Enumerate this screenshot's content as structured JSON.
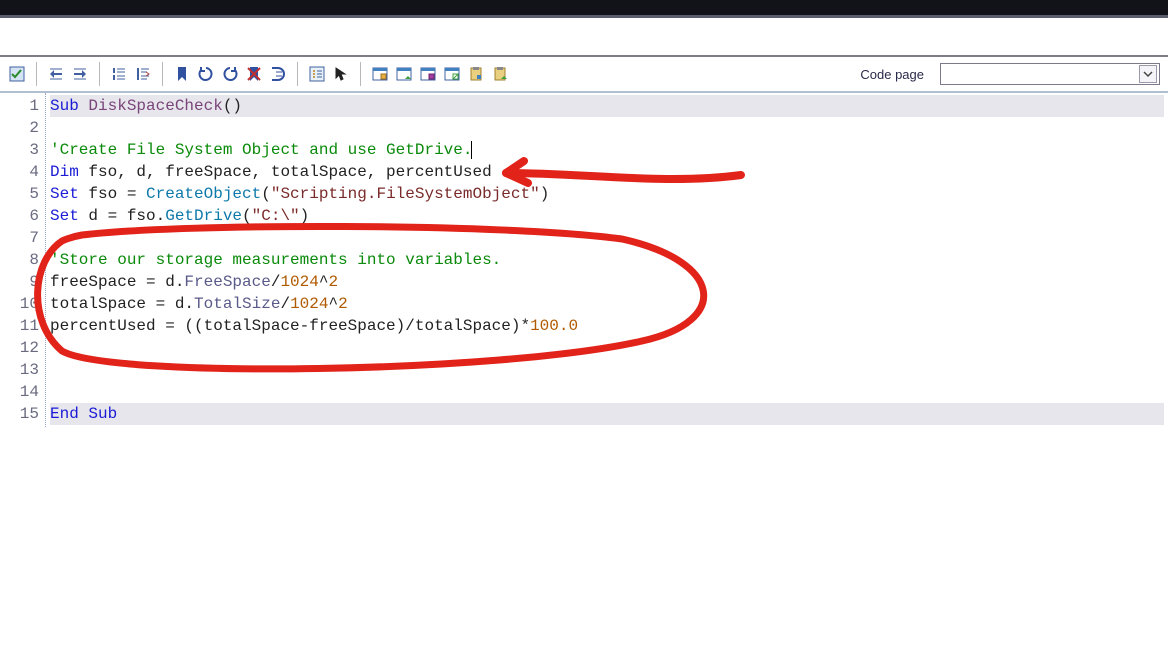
{
  "toolbar": {
    "codepage_label": "Code page",
    "codepage_value": "",
    "buttons": [
      "check-syntax-icon",
      "indent-left-icon",
      "indent-right-icon",
      "outdent-icon",
      "dedent-icon",
      "bookmark-icon",
      "refresh-icon",
      "redo-icon",
      "delete-bookmark-icon",
      "go-to-icon",
      "object-list-icon",
      "pointer-icon",
      "window1-icon",
      "window2-icon",
      "window3-icon",
      "window4-icon",
      "clipboard1-icon",
      "clipboard2-icon"
    ]
  },
  "editor": {
    "lines": [
      {
        "n": 1,
        "hl": true,
        "segs": [
          {
            "t": "Sub ",
            "c": "kw"
          },
          {
            "t": "DiskSpaceCheck",
            "c": "fnname"
          },
          {
            "t": "()",
            "c": "op"
          }
        ]
      },
      {
        "n": 2,
        "hl": false,
        "segs": []
      },
      {
        "n": 3,
        "hl": false,
        "segs": [
          {
            "t": "'Create File System Object and use GetDrive.",
            "c": "cmt"
          },
          {
            "t": "|",
            "c": "caret"
          }
        ]
      },
      {
        "n": 4,
        "hl": false,
        "segs": [
          {
            "t": "Dim ",
            "c": "kw"
          },
          {
            "t": "fso, d, freeSpace, totalSpace, percentUsed",
            "c": "op"
          }
        ]
      },
      {
        "n": 5,
        "hl": false,
        "segs": [
          {
            "t": "Set ",
            "c": "kw"
          },
          {
            "t": "fso = ",
            "c": "op"
          },
          {
            "t": "CreateObject",
            "c": "fn"
          },
          {
            "t": "(",
            "c": "op"
          },
          {
            "t": "\"Scripting.FileSystemObject\"",
            "c": "str"
          },
          {
            "t": ")",
            "c": "op"
          }
        ]
      },
      {
        "n": 6,
        "hl": false,
        "segs": [
          {
            "t": "Set ",
            "c": "kw"
          },
          {
            "t": "d = fso.",
            "c": "op"
          },
          {
            "t": "GetDrive",
            "c": "fn"
          },
          {
            "t": "(",
            "c": "op"
          },
          {
            "t": "\"C:\\\"",
            "c": "str"
          },
          {
            "t": ")",
            "c": "op"
          }
        ]
      },
      {
        "n": 7,
        "hl": false,
        "segs": []
      },
      {
        "n": 8,
        "hl": false,
        "segs": [
          {
            "t": "'Store our storage measurements into variables.",
            "c": "cmt"
          }
        ]
      },
      {
        "n": 9,
        "hl": false,
        "segs": [
          {
            "t": "freeSpace = d.",
            "c": "op"
          },
          {
            "t": "FreeSpace",
            "c": "ident"
          },
          {
            "t": "/",
            "c": "op"
          },
          {
            "t": "1024",
            "c": "const"
          },
          {
            "t": "^",
            "c": "op"
          },
          {
            "t": "2",
            "c": "const"
          }
        ]
      },
      {
        "n": 10,
        "hl": false,
        "segs": [
          {
            "t": "totalSpace = d.",
            "c": "op"
          },
          {
            "t": "TotalSize",
            "c": "ident"
          },
          {
            "t": "/",
            "c": "op"
          },
          {
            "t": "1024",
            "c": "const"
          },
          {
            "t": "^",
            "c": "op"
          },
          {
            "t": "2",
            "c": "const"
          }
        ]
      },
      {
        "n": 11,
        "hl": false,
        "segs": [
          {
            "t": "percentUsed = ((totalSpace-freeSpace)/totalSpace)*",
            "c": "op"
          },
          {
            "t": "100.0",
            "c": "const"
          }
        ]
      },
      {
        "n": 12,
        "hl": false,
        "segs": []
      },
      {
        "n": 13,
        "hl": false,
        "segs": []
      },
      {
        "n": 14,
        "hl": false,
        "segs": []
      },
      {
        "n": 15,
        "hl": true,
        "segs": [
          {
            "t": "End Sub",
            "c": "kw"
          }
        ]
      }
    ]
  }
}
